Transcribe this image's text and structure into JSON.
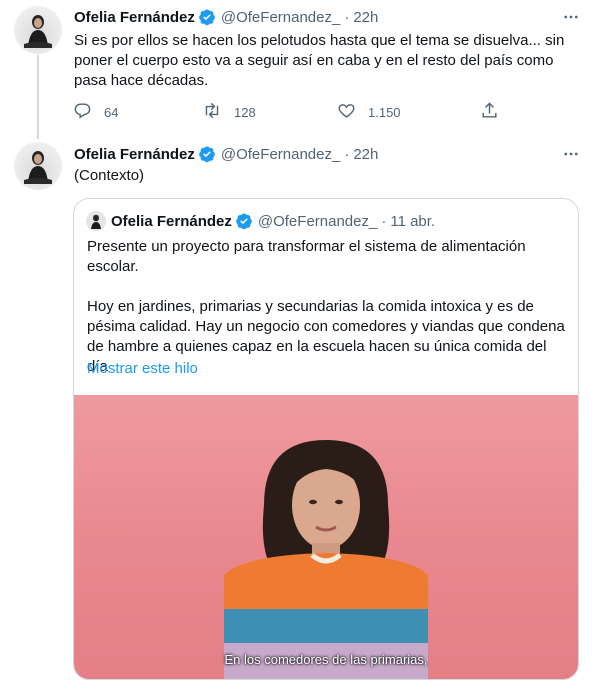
{
  "tweet1": {
    "name": "Ofelia Fernández",
    "handle": "@OfeFernandez_",
    "separator": "·",
    "time": "22h",
    "text": "Si es por ellos se hacen los pelotudos hasta que el tema se disuelva... sin poner el cuerpo esto va a seguir así en caba y en el resto del país como pasa hace décadas.",
    "replies": "64",
    "retweets": "128",
    "likes": "1.150"
  },
  "tweet2": {
    "name": "Ofelia Fernández",
    "handle": "@OfeFernandez_",
    "separator": "·",
    "time": "22h",
    "text": "(Contexto)"
  },
  "quote": {
    "name": "Ofelia Fernández",
    "handle": "@OfeFernandez_",
    "separator": "·",
    "time": "11 abr.",
    "paragraph1": "Presente un proyecto para transformar el sistema de alimentación escolar.",
    "paragraph2": "Hoy en jardines, primarias y secundarias la comida intoxica y es de pésima calidad. Hay un negocio con comedores y viandas que condena de hambre a quienes capaz en la escuela hacen su única comida del día",
    "show_thread": "Mostrar este hilo",
    "video_caption": "En los comedores de las primarias,"
  },
  "colors": {
    "accent": "#1d9bf0",
    "secondary_text": "#536471",
    "border": "#cfd9de",
    "video_background": "#e98b91"
  },
  "icons": [
    "verified-badge-icon",
    "more-icon",
    "reply-icon",
    "retweet-icon",
    "like-icon",
    "share-icon"
  ]
}
